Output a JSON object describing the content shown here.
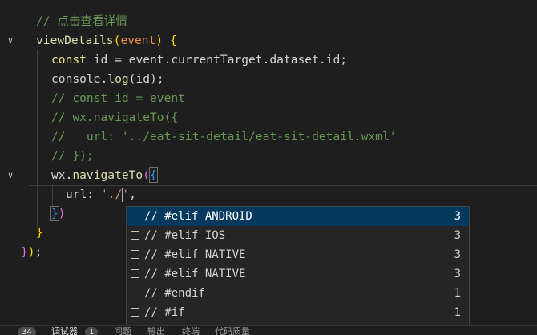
{
  "code": {
    "l1": "// 点击查看详情",
    "l2_fn": "viewDetails",
    "l2_open": "(",
    "l2_param": "event",
    "l2_close": ")",
    "l2_brace": " {",
    "l3_kw": "const",
    "l3_rest": " id = event.currentTarget.dataset.id;",
    "l4_obj": "console.",
    "l4_fn": "log",
    "l4_rest": "(id);",
    "l5": "// const id = event",
    "l6": "// wx.navigateTo({",
    "l7": "//   url: '../eat-sit-detail/eat-sit-detail.wxml'",
    "l8": "// });",
    "l9_obj": "wx.",
    "l9_fn": "navigateTo",
    "l9_paren": "(",
    "l9_brace": "{",
    "l10_key": "url: ",
    "l10_str": "'./",
    "l10_str_end": "'",
    "l10_comma": ",",
    "l11_brace": "}",
    "l11_paren": ")",
    "l12": "}",
    "l13_brace": "}",
    "l13_paren": ")",
    "l13_semi": ";"
  },
  "suggest": {
    "items": [
      {
        "prefix": "// #",
        "label": "elif ANDROID",
        "count": "3"
      },
      {
        "prefix": "// #",
        "label": "elif IOS",
        "count": "3"
      },
      {
        "prefix": "// #",
        "label": "elif NATIVE",
        "count": "3"
      },
      {
        "prefix": "// #",
        "label": "elif NATIVE",
        "count": "3"
      },
      {
        "prefix": "// #",
        "label": "endif",
        "count": "1"
      },
      {
        "prefix": "// #",
        "label": "if",
        "count": "1"
      }
    ]
  },
  "panel": {
    "problems_count": "34",
    "debugger_label": "调试器",
    "debugger_count": "1",
    "issues_label": "问题",
    "output_label": "输出",
    "terminal_label": "终端",
    "code_quality_label": "代码质量"
  },
  "colors": {
    "comment": "#6a9955",
    "function": "#dcdcaa",
    "keyword": "#f0e68c",
    "string": "#ce9178",
    "suggest_active": "#04395e"
  }
}
